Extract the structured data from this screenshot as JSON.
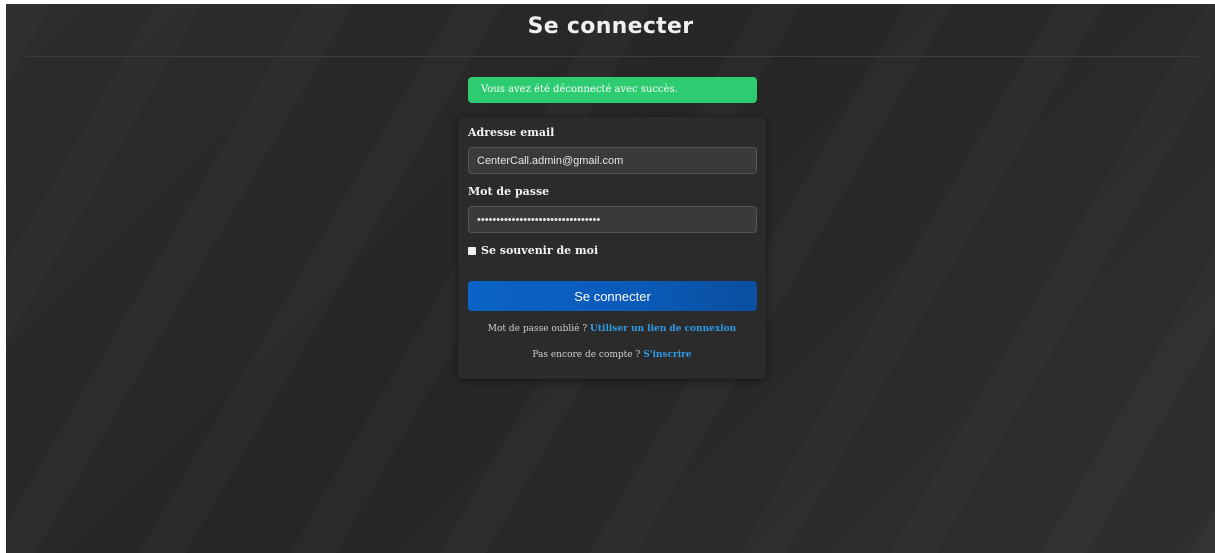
{
  "header": {
    "title": "Se connecter"
  },
  "alert": {
    "message": "Vous avez été déconnecté avec succès.",
    "color": "#2ecc71"
  },
  "form": {
    "email": {
      "label": "Adresse email",
      "value": "CenterCall.admin@gmail.com"
    },
    "password": {
      "label": "Mot de passe",
      "value": "••••••••••••••••••••••••••••••••"
    },
    "remember": {
      "label": "Se souvenir de moi",
      "checked": true
    },
    "submit_label": "Se connecter"
  },
  "footer": {
    "forgot_text": "Mot de passe oublié ?",
    "forgot_link": "Utiliser un lien de connexion",
    "signup_text": "Pas encore de compte ?",
    "signup_link": "S'inscrire"
  },
  "colors": {
    "accent": "#0a63c6",
    "link": "#2f9be8",
    "background": "#2a2a2a"
  }
}
